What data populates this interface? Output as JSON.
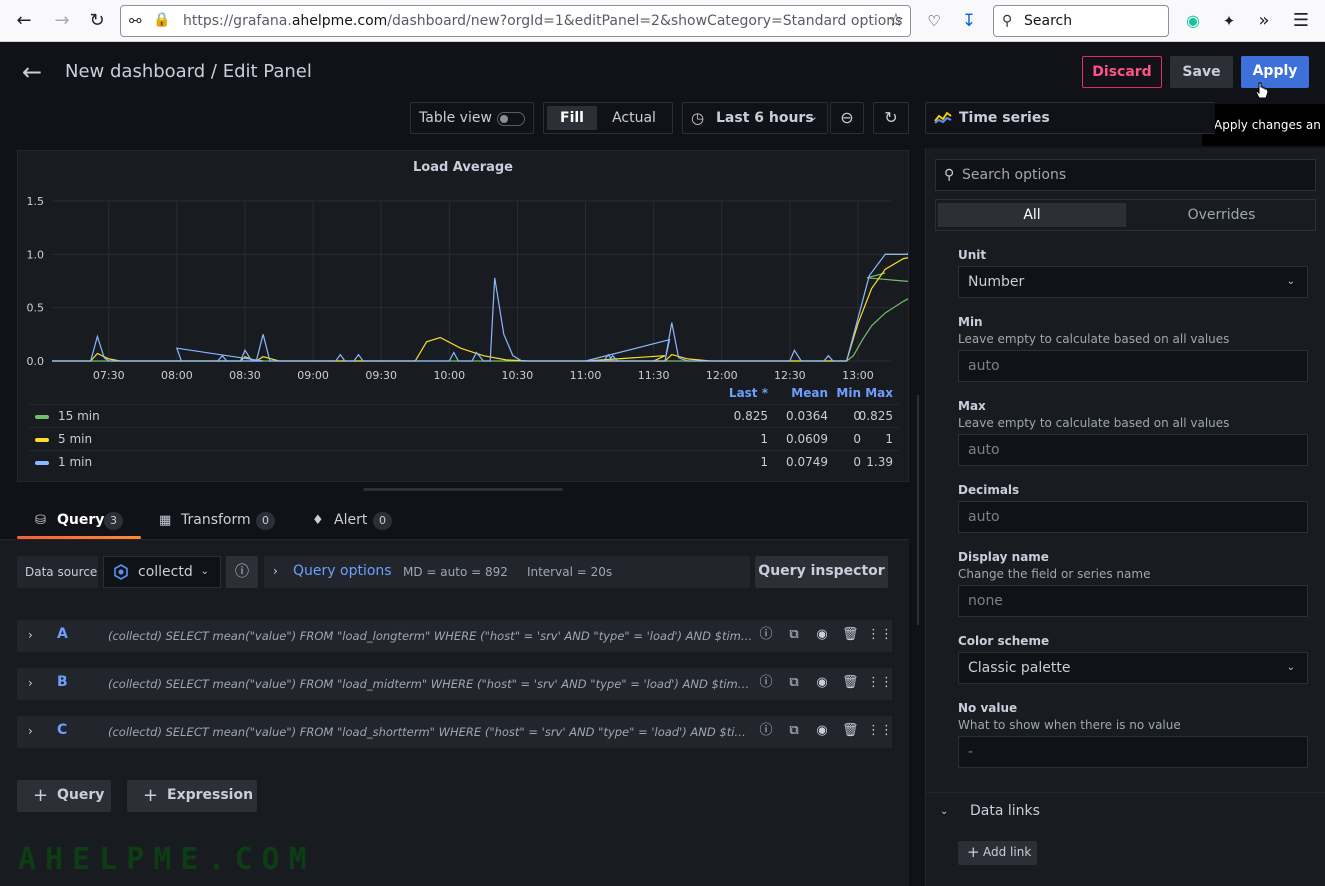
{
  "browser": {
    "url_prefix": "https://grafana.",
    "url_domain": "ahelpme.com",
    "url_rest": "/dashboard/new?orgId=1&editPanel=2&showCategory=Standard options",
    "search_label": "Search"
  },
  "header": {
    "title": "New dashboard / Edit Panel",
    "discard": "Discard",
    "save": "Save",
    "apply": "Apply",
    "tooltip": "Apply changes an"
  },
  "toolbar": {
    "table_view": "Table view",
    "fill": "Fill",
    "actual": "Actual",
    "time_range": "Last 6 hours",
    "viz_name": "Time series"
  },
  "panel": {
    "title": "Load Average",
    "legend_headers": {
      "last": "Last *",
      "mean": "Mean",
      "min": "Min",
      "max": "Max"
    },
    "legend_rows": [
      {
        "name": "15 min",
        "color": "#73bf69",
        "last": "0.825",
        "mean": "0.0364",
        "min": "0",
        "max": "0.825"
      },
      {
        "name": "5 min",
        "color": "#fade2a",
        "last": "1",
        "mean": "0.0609",
        "min": "0",
        "max": "1"
      },
      {
        "name": "1 min",
        "color": "#8ab8ff",
        "last": "1",
        "mean": "0.0749",
        "min": "0",
        "max": "1.39"
      }
    ]
  },
  "chart_data": {
    "type": "line",
    "title": "Load Average",
    "x_tick_labels": [
      "07:30",
      "08:00",
      "08:30",
      "09:00",
      "09:30",
      "10:00",
      "10:30",
      "11:00",
      "11:30",
      "12:00",
      "12:30",
      "13:00"
    ],
    "y_tick_labels": [
      "0.0",
      "0.5",
      "1.0",
      "1.5"
    ],
    "ylim": [
      0,
      1.5
    ],
    "x_range_minutes": [
      7.05,
      13.15
    ],
    "grid": true,
    "legend_placement": "bottom",
    "series": [
      {
        "name": "15 min",
        "color": "#73bf69",
        "points": [
          [
            7.05,
            0
          ],
          [
            12.55,
            0
          ],
          [
            12.58,
            0.05
          ],
          [
            12.62,
            0.2
          ],
          [
            12.66,
            0.33
          ],
          [
            12.72,
            0.45
          ],
          [
            12.8,
            0.56
          ],
          [
            12.88,
            0.65
          ],
          [
            12.96,
            0.72
          ],
          [
            13.04,
            0.78
          ],
          [
            13.12,
            0.825
          ]
        ]
      },
      {
        "name": "5 min",
        "color": "#fade2a",
        "points": [
          [
            7.05,
            0
          ],
          [
            7.22,
            0
          ],
          [
            7.25,
            0.07
          ],
          [
            7.3,
            0.02
          ],
          [
            7.35,
            0
          ],
          [
            7.88,
            0
          ],
          [
            7.9,
            0.04
          ],
          [
            7.95,
            0
          ],
          [
            8.35,
            0
          ],
          [
            8.38,
            0.04
          ],
          [
            8.45,
            0
          ],
          [
            9.45,
            0
          ],
          [
            9.5,
            0.18
          ],
          [
            9.56,
            0.22
          ],
          [
            9.65,
            0.12
          ],
          [
            9.75,
            0.05
          ],
          [
            9.85,
            0.01
          ],
          [
            9.95,
            0
          ],
          [
            10.9,
            0
          ],
          [
            10.95,
            0.05
          ],
          [
            11.0,
            0
          ],
          [
            11.35,
            0
          ],
          [
            11.38,
            0.06
          ],
          [
            11.45,
            0.02
          ],
          [
            11.55,
            0
          ],
          [
            12.55,
            0
          ],
          [
            12.6,
            0.35
          ],
          [
            12.66,
            0.68
          ],
          [
            12.72,
            0.86
          ],
          [
            12.8,
            0.96
          ],
          [
            12.9,
            1.0
          ],
          [
            13.12,
            1.0
          ]
        ]
      },
      {
        "name": "1 min",
        "color": "#8ab8ff",
        "points": [
          [
            7.05,
            0
          ],
          [
            7.22,
            0
          ],
          [
            7.25,
            0.23
          ],
          [
            7.28,
            0.03
          ],
          [
            7.3,
            0
          ],
          [
            7.78,
            0
          ],
          [
            7.8,
            0.05
          ],
          [
            7.82,
            0
          ],
          [
            7.88,
            0
          ],
          [
            7.9,
            0.1
          ],
          [
            7.93,
            0
          ],
          [
            7.98,
            0
          ],
          [
            8.0,
            0.12
          ],
          [
            8.02,
            0
          ],
          [
            8.35,
            0
          ],
          [
            8.38,
            0.25
          ],
          [
            8.41,
            0
          ],
          [
            9.1,
            0
          ],
          [
            9.12,
            0.06
          ],
          [
            9.14,
            0
          ],
          [
            9.18,
            0
          ],
          [
            9.2,
            0.06
          ],
          [
            9.22,
            0
          ],
          [
            9.6,
            0
          ],
          [
            9.62,
            0.08
          ],
          [
            9.64,
            0
          ],
          [
            9.7,
            0
          ],
          [
            9.72,
            0.08
          ],
          [
            9.75,
            0
          ],
          [
            9.78,
            0
          ],
          [
            9.8,
            0.78
          ],
          [
            9.84,
            0.25
          ],
          [
            9.88,
            0.05
          ],
          [
            9.92,
            0
          ],
          [
            10.7,
            0
          ],
          [
            10.72,
            0.05
          ],
          [
            10.74,
            0
          ],
          [
            10.95,
            0
          ],
          [
            10.97,
            0.2
          ],
          [
            11.0,
            0
          ],
          [
            11.08,
            0
          ],
          [
            11.1,
            0.06
          ],
          [
            11.12,
            0
          ],
          [
            11.35,
            0
          ],
          [
            11.38,
            0.36
          ],
          [
            11.41,
            0.03
          ],
          [
            11.45,
            0
          ],
          [
            12.3,
            0
          ],
          [
            12.32,
            0.1
          ],
          [
            12.35,
            0
          ],
          [
            12.45,
            0
          ],
          [
            12.47,
            0.05
          ],
          [
            12.49,
            0
          ],
          [
            12.55,
            0
          ],
          [
            12.65,
            0.8
          ],
          [
            12.72,
            1.0
          ],
          [
            12.82,
            1.0
          ],
          [
            12.86,
            1.38
          ],
          [
            12.89,
            1.15
          ],
          [
            12.92,
            1.02
          ],
          [
            12.96,
            1.0
          ],
          [
            13.12,
            1.0
          ]
        ]
      }
    ]
  },
  "query_tabs": [
    {
      "label": "Query",
      "count": "3"
    },
    {
      "label": "Transform",
      "count": "0"
    },
    {
      "label": "Alert",
      "count": "0"
    }
  ],
  "query_bar": {
    "ds_label": "Data source",
    "ds_name": "collectd",
    "options_label": "Query options",
    "options_meta": "MD = auto = 892     Interval = 20s",
    "inspector": "Query inspector"
  },
  "queries": [
    {
      "ref": "A",
      "sql": "(collectd)  SELECT mean(\"value\") FROM \"load_longterm\" WHERE (\"host\" = 'srv' AND \"type\" = 'load') AND $timeFilter GROUP BY time($__interval) fill(null)"
    },
    {
      "ref": "B",
      "sql": "(collectd)  SELECT mean(\"value\") FROM \"load_midterm\" WHERE (\"host\" = 'srv' AND \"type\" = 'load') AND $timeFilter GROUP BY time($__interval) fill(null)"
    },
    {
      "ref": "C",
      "sql": "(collectd)  SELECT mean(\"value\") FROM \"load_shortterm\" WHERE (\"host\" = 'srv' AND \"type\" = 'load') AND $timeFilter GROUP BY time($__interval) fill(null)"
    }
  ],
  "add_buttons": {
    "query": "Query",
    "expression": "Expression"
  },
  "watermark": "AHELPME.COM",
  "options": {
    "search_placeholder": "Search options",
    "tab_all": "All",
    "tab_overrides": "Overrides",
    "unit_label": "Unit",
    "unit_value": "Number",
    "min_label": "Min",
    "min_desc": "Leave empty to calculate based on all values",
    "min_placeholder": "auto",
    "max_label": "Max",
    "max_desc": "Leave empty to calculate based on all values",
    "max_placeholder": "auto",
    "decimals_label": "Decimals",
    "decimals_placeholder": "auto",
    "display_name_label": "Display name",
    "display_name_desc": "Change the field or series name",
    "display_name_placeholder": "none",
    "color_scheme_label": "Color scheme",
    "color_scheme_value": "Classic palette",
    "no_value_label": "No value",
    "no_value_desc": "What to show when there is no value",
    "no_value_placeholder": "-",
    "data_links_title": "Data links",
    "add_link": "Add link"
  }
}
